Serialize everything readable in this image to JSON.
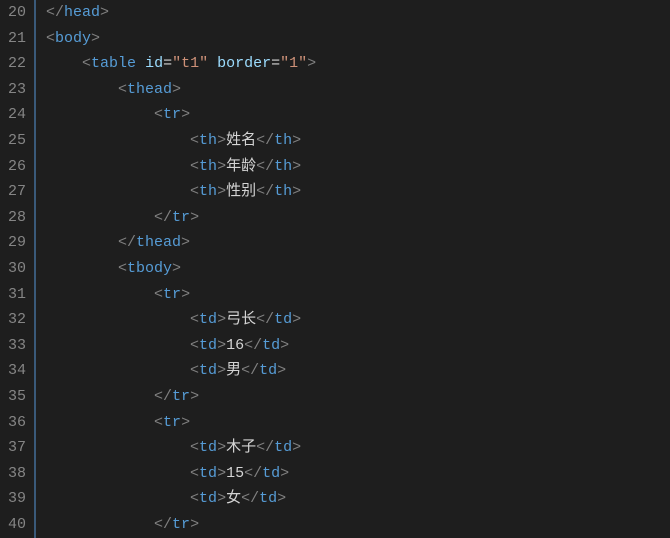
{
  "lineStart": 20,
  "lineCount": 21,
  "lines": [
    {
      "indent": 0,
      "tokens": [
        {
          "t": "tag-bracket",
          "v": "</"
        },
        {
          "t": "tag-name",
          "v": "head"
        },
        {
          "t": "tag-bracket",
          "v": ">"
        }
      ]
    },
    {
      "indent": 0,
      "tokens": [
        {
          "t": "tag-bracket",
          "v": "<"
        },
        {
          "t": "tag-name",
          "v": "body"
        },
        {
          "t": "tag-bracket",
          "v": ">"
        }
      ]
    },
    {
      "indent": 1,
      "tokens": [
        {
          "t": "tag-bracket",
          "v": "<"
        },
        {
          "t": "tag-name",
          "v": "table"
        },
        {
          "t": "text-content",
          "v": " "
        },
        {
          "t": "attr-name",
          "v": "id"
        },
        {
          "t": "attr-eq",
          "v": "="
        },
        {
          "t": "attr-value",
          "v": "\"t1\""
        },
        {
          "t": "text-content",
          "v": " "
        },
        {
          "t": "attr-name",
          "v": "border"
        },
        {
          "t": "attr-eq",
          "v": "="
        },
        {
          "t": "attr-value",
          "v": "\"1\""
        },
        {
          "t": "tag-bracket",
          "v": ">"
        }
      ]
    },
    {
      "indent": 2,
      "tokens": [
        {
          "t": "tag-bracket",
          "v": "<"
        },
        {
          "t": "tag-name",
          "v": "thead"
        },
        {
          "t": "tag-bracket",
          "v": ">"
        }
      ]
    },
    {
      "indent": 3,
      "tokens": [
        {
          "t": "tag-bracket",
          "v": "<"
        },
        {
          "t": "tag-name",
          "v": "tr"
        },
        {
          "t": "tag-bracket",
          "v": ">"
        }
      ]
    },
    {
      "indent": 4,
      "tokens": [
        {
          "t": "tag-bracket",
          "v": "<"
        },
        {
          "t": "tag-name",
          "v": "th"
        },
        {
          "t": "tag-bracket",
          "v": ">"
        },
        {
          "t": "text-content",
          "v": "姓名"
        },
        {
          "t": "tag-bracket",
          "v": "</"
        },
        {
          "t": "tag-name",
          "v": "th"
        },
        {
          "t": "tag-bracket",
          "v": ">"
        }
      ]
    },
    {
      "indent": 4,
      "tokens": [
        {
          "t": "tag-bracket",
          "v": "<"
        },
        {
          "t": "tag-name",
          "v": "th"
        },
        {
          "t": "tag-bracket",
          "v": ">"
        },
        {
          "t": "text-content",
          "v": "年龄"
        },
        {
          "t": "tag-bracket",
          "v": "</"
        },
        {
          "t": "tag-name",
          "v": "th"
        },
        {
          "t": "tag-bracket",
          "v": ">"
        }
      ]
    },
    {
      "indent": 4,
      "tokens": [
        {
          "t": "tag-bracket",
          "v": "<"
        },
        {
          "t": "tag-name",
          "v": "th"
        },
        {
          "t": "tag-bracket",
          "v": ">"
        },
        {
          "t": "text-content",
          "v": "性别"
        },
        {
          "t": "tag-bracket",
          "v": "</"
        },
        {
          "t": "tag-name",
          "v": "th"
        },
        {
          "t": "tag-bracket",
          "v": ">"
        }
      ]
    },
    {
      "indent": 3,
      "tokens": [
        {
          "t": "tag-bracket",
          "v": "</"
        },
        {
          "t": "tag-name",
          "v": "tr"
        },
        {
          "t": "tag-bracket",
          "v": ">"
        }
      ]
    },
    {
      "indent": 2,
      "tokens": [
        {
          "t": "tag-bracket",
          "v": "</"
        },
        {
          "t": "tag-name",
          "v": "thead"
        },
        {
          "t": "tag-bracket",
          "v": ">"
        }
      ]
    },
    {
      "indent": 2,
      "tokens": [
        {
          "t": "tag-bracket",
          "v": "<"
        },
        {
          "t": "tag-name",
          "v": "tbody"
        },
        {
          "t": "tag-bracket",
          "v": ">"
        }
      ]
    },
    {
      "indent": 3,
      "tokens": [
        {
          "t": "tag-bracket",
          "v": "<"
        },
        {
          "t": "tag-name",
          "v": "tr"
        },
        {
          "t": "tag-bracket",
          "v": ">"
        }
      ]
    },
    {
      "indent": 4,
      "tokens": [
        {
          "t": "tag-bracket",
          "v": "<"
        },
        {
          "t": "tag-name",
          "v": "td"
        },
        {
          "t": "tag-bracket",
          "v": ">"
        },
        {
          "t": "text-content",
          "v": "弓长"
        },
        {
          "t": "tag-bracket",
          "v": "</"
        },
        {
          "t": "tag-name",
          "v": "td"
        },
        {
          "t": "tag-bracket",
          "v": ">"
        }
      ]
    },
    {
      "indent": 4,
      "tokens": [
        {
          "t": "tag-bracket",
          "v": "<"
        },
        {
          "t": "tag-name",
          "v": "td"
        },
        {
          "t": "tag-bracket",
          "v": ">"
        },
        {
          "t": "text-content",
          "v": "16"
        },
        {
          "t": "tag-bracket",
          "v": "</"
        },
        {
          "t": "tag-name",
          "v": "td"
        },
        {
          "t": "tag-bracket",
          "v": ">"
        }
      ]
    },
    {
      "indent": 4,
      "tokens": [
        {
          "t": "tag-bracket",
          "v": "<"
        },
        {
          "t": "tag-name",
          "v": "td"
        },
        {
          "t": "tag-bracket",
          "v": ">"
        },
        {
          "t": "text-content",
          "v": "男"
        },
        {
          "t": "tag-bracket",
          "v": "</"
        },
        {
          "t": "tag-name",
          "v": "td"
        },
        {
          "t": "tag-bracket",
          "v": ">"
        }
      ]
    },
    {
      "indent": 3,
      "tokens": [
        {
          "t": "tag-bracket",
          "v": "</"
        },
        {
          "t": "tag-name",
          "v": "tr"
        },
        {
          "t": "tag-bracket",
          "v": ">"
        }
      ]
    },
    {
      "indent": 3,
      "tokens": [
        {
          "t": "tag-bracket",
          "v": "<"
        },
        {
          "t": "tag-name",
          "v": "tr"
        },
        {
          "t": "tag-bracket",
          "v": ">"
        }
      ]
    },
    {
      "indent": 4,
      "tokens": [
        {
          "t": "tag-bracket",
          "v": "<"
        },
        {
          "t": "tag-name",
          "v": "td"
        },
        {
          "t": "tag-bracket",
          "v": ">"
        },
        {
          "t": "text-content",
          "v": "木子"
        },
        {
          "t": "tag-bracket",
          "v": "</"
        },
        {
          "t": "tag-name",
          "v": "td"
        },
        {
          "t": "tag-bracket",
          "v": ">"
        }
      ]
    },
    {
      "indent": 4,
      "tokens": [
        {
          "t": "tag-bracket",
          "v": "<"
        },
        {
          "t": "tag-name",
          "v": "td"
        },
        {
          "t": "tag-bracket",
          "v": ">"
        },
        {
          "t": "text-content",
          "v": "15"
        },
        {
          "t": "tag-bracket",
          "v": "</"
        },
        {
          "t": "tag-name",
          "v": "td"
        },
        {
          "t": "tag-bracket",
          "v": ">"
        }
      ]
    },
    {
      "indent": 4,
      "tokens": [
        {
          "t": "tag-bracket",
          "v": "<"
        },
        {
          "t": "tag-name",
          "v": "td"
        },
        {
          "t": "tag-bracket",
          "v": ">"
        },
        {
          "t": "text-content",
          "v": "女"
        },
        {
          "t": "tag-bracket",
          "v": "</"
        },
        {
          "t": "tag-name",
          "v": "td"
        },
        {
          "t": "tag-bracket",
          "v": ">"
        }
      ]
    },
    {
      "indent": 3,
      "tokens": [
        {
          "t": "tag-bracket",
          "v": "</"
        },
        {
          "t": "tag-name",
          "v": "tr"
        },
        {
          "t": "tag-bracket",
          "v": ">"
        }
      ]
    }
  ]
}
